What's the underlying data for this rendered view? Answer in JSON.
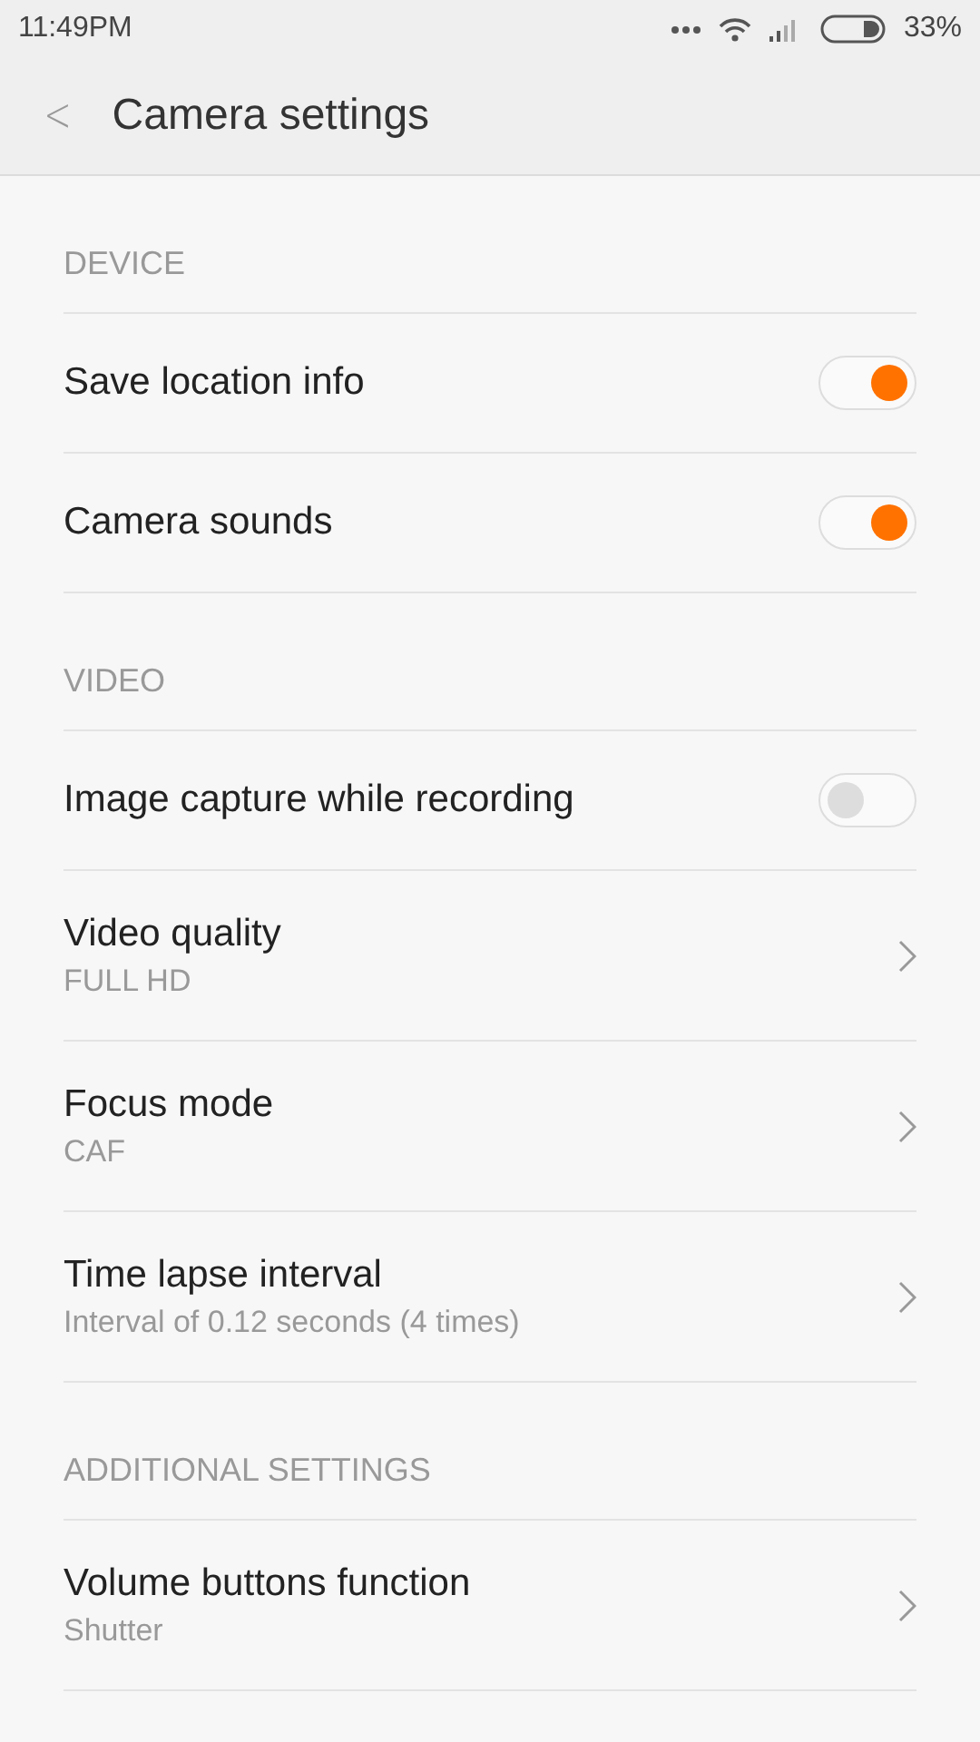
{
  "status_bar": {
    "time": "11:49PM",
    "battery": "33%"
  },
  "header": {
    "back": "<",
    "title": "Camera settings"
  },
  "sections": [
    {
      "title": "DEVICE",
      "items": [
        {
          "kind": "toggle",
          "label": "Save location info",
          "on": true
        },
        {
          "kind": "toggle",
          "label": "Camera sounds",
          "on": true
        }
      ]
    },
    {
      "title": "VIDEO",
      "items": [
        {
          "kind": "toggle",
          "label": "Image capture while recording",
          "on": false
        },
        {
          "kind": "link",
          "label": "Video quality",
          "value": "FULL HD"
        },
        {
          "kind": "link",
          "label": "Focus mode",
          "value": "CAF"
        },
        {
          "kind": "link",
          "label": "Time lapse interval",
          "value": "Interval of 0.12 seconds (4 times)"
        }
      ]
    },
    {
      "title": "ADDITIONAL SETTINGS",
      "items": [
        {
          "kind": "link",
          "label": "Volume buttons function",
          "value": "Shutter"
        }
      ]
    }
  ]
}
